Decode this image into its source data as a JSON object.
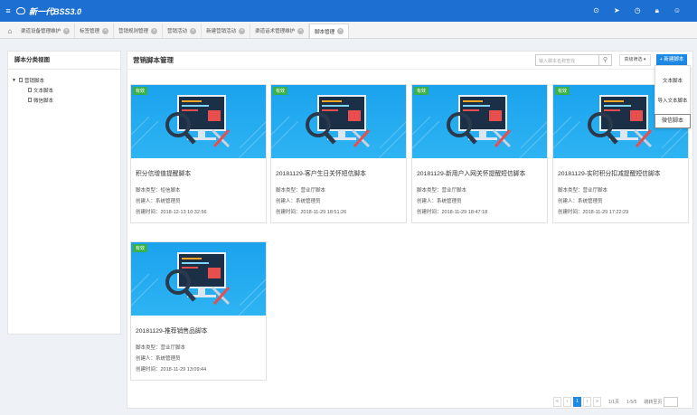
{
  "app": {
    "title": "新一代BSS3.0"
  },
  "tabs": [
    {
      "label": "渠道设备管理维护"
    },
    {
      "label": "标签管理"
    },
    {
      "label": "营销规则管理"
    },
    {
      "label": "营销活动"
    },
    {
      "label": "新建营销活动"
    },
    {
      "label": "渠道话术管理维护"
    },
    {
      "label": "脚本管理"
    }
  ],
  "sidebar": {
    "title": "脚本分类视图",
    "root": "营销脚本",
    "children": [
      "文本脚本",
      "微信脚本"
    ]
  },
  "main": {
    "title": "营销脚本管理",
    "search_placeholder": "输入脚本名称查找",
    "filter_label": "高级筛选 ▾",
    "new_button": "+ 新建脚本",
    "badge": "有效"
  },
  "dropdown": {
    "items": [
      "文本脚本",
      "导入文本脚本",
      "微信脚本"
    ]
  },
  "cards": [
    {
      "title": "积分信增值提醒脚本",
      "type": "脚本类型：短信脚本",
      "creator": "创建人：系统管理员",
      "created": "创建时间：2018-12-13 10:32:56"
    },
    {
      "title": "20181129-客户生日关怀短信脚本",
      "type": "脚本类型：营业厅脚本",
      "creator": "创建人：系统管理员",
      "created": "创建时间：2018-11-29 18:51:26"
    },
    {
      "title": "20181129-新用户入网关怀提醒短信脚本",
      "type": "脚本类型：营业厅脚本",
      "creator": "创建人：系统管理员",
      "created": "创建时间：2018-11-29 18:47:18"
    },
    {
      "title": "20181129-实时积分扣减提醒短信脚本",
      "type": "脚本类型：营业厅脚本",
      "creator": "创建人：系统管理员",
      "created": "创建时间：2018-11-29 17:22:29"
    },
    {
      "title": "20181129-推荐销售品脚本",
      "type": "脚本类型：营业厅脚本",
      "creator": "创建人：系统管理员",
      "created": "创建时间：2018-11-29 13:09:44"
    }
  ],
  "pagination": {
    "current_page": "1",
    "page_info": "1/1页",
    "range": "1-5/5",
    "goto_label": "跳转至页"
  },
  "colors": {
    "brand": "#1d6fd1",
    "accent": "#1e88e5",
    "badge": "#3ab04a"
  }
}
